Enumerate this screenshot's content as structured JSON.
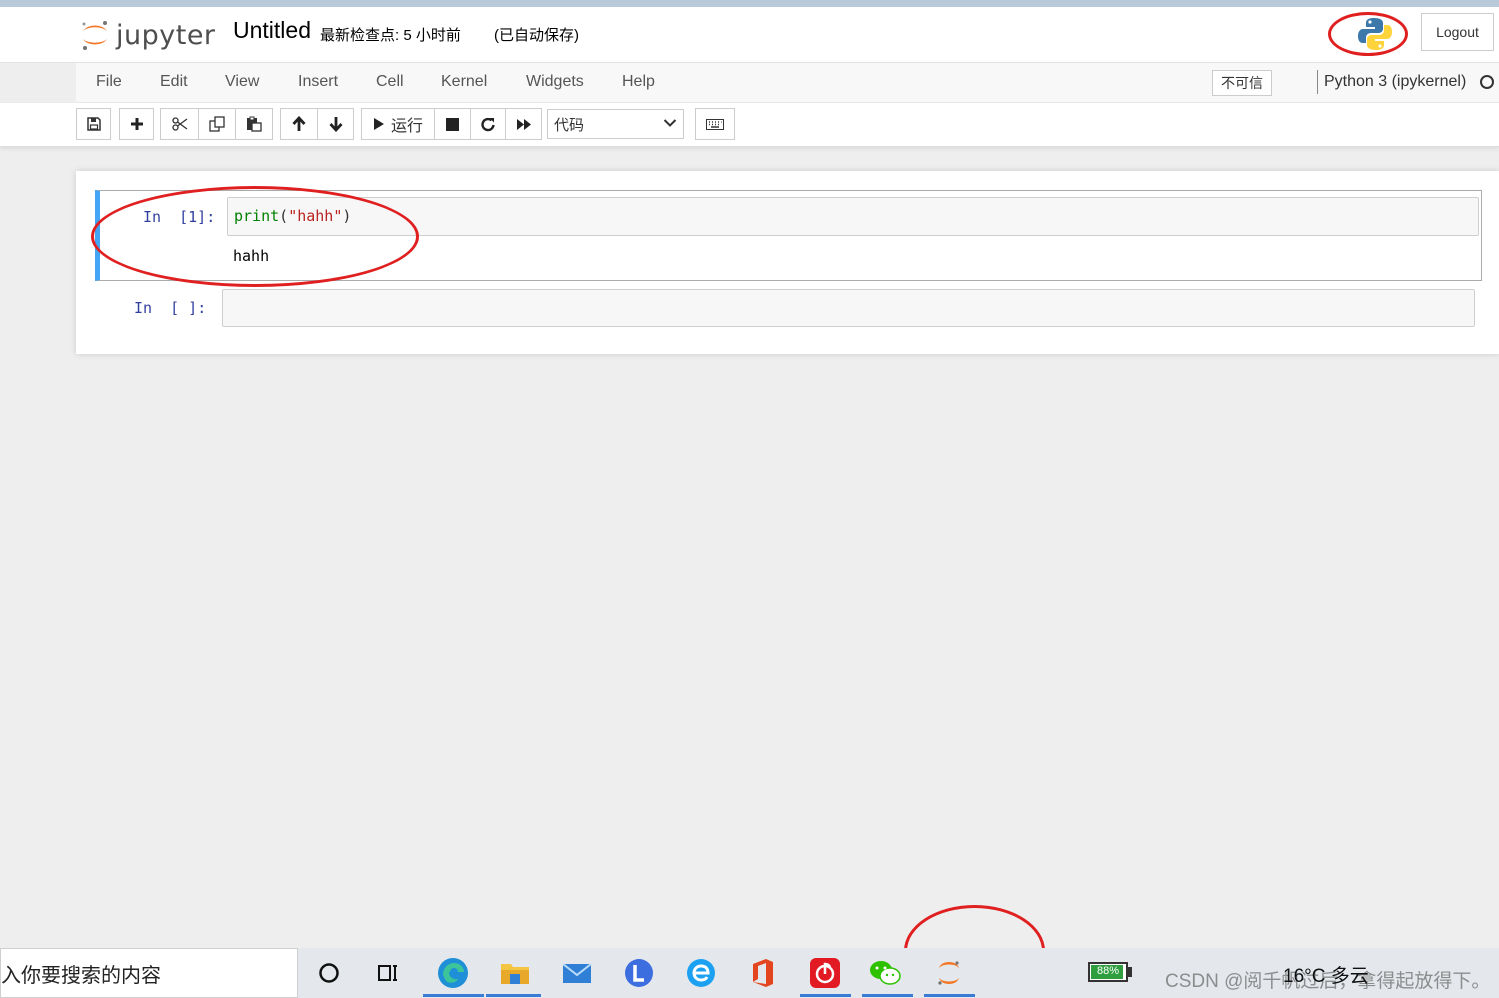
{
  "header": {
    "logo_text": "jupyter",
    "notebook_title": "Untitled",
    "checkpoint": "最新检查点: 5 小时前",
    "autosave": "(已自动保存)",
    "logout_label": "Logout"
  },
  "menubar": {
    "items": [
      "File",
      "Edit",
      "View",
      "Insert",
      "Cell",
      "Kernel",
      "Widgets",
      "Help"
    ],
    "trust_label": "不可信",
    "kernel_name": "Python 3 (ipykernel)"
  },
  "toolbar": {
    "run_label": "运行",
    "cell_type": "代码"
  },
  "cells": [
    {
      "prompt": "In  [1]:",
      "code_fn": "print",
      "code_open": "(",
      "code_str": "\"hahh\"",
      "code_close": ")",
      "output": "hahh"
    },
    {
      "prompt": "In  [ ]:",
      "code_fn": "",
      "output": ""
    }
  ],
  "taskbar": {
    "search_text": "入你要搜索的内容",
    "battery": "88%",
    "weather": "16°C 多云",
    "watermark": "CSDN @阅千帆过后，拿得起放得下。"
  },
  "colors": {
    "selected_cell_bar": "#42a5f5",
    "annotation_red": "#e02020",
    "prompt_blue": "#303f9f",
    "keyword_green": "#008000",
    "string_red": "#ba2121"
  }
}
